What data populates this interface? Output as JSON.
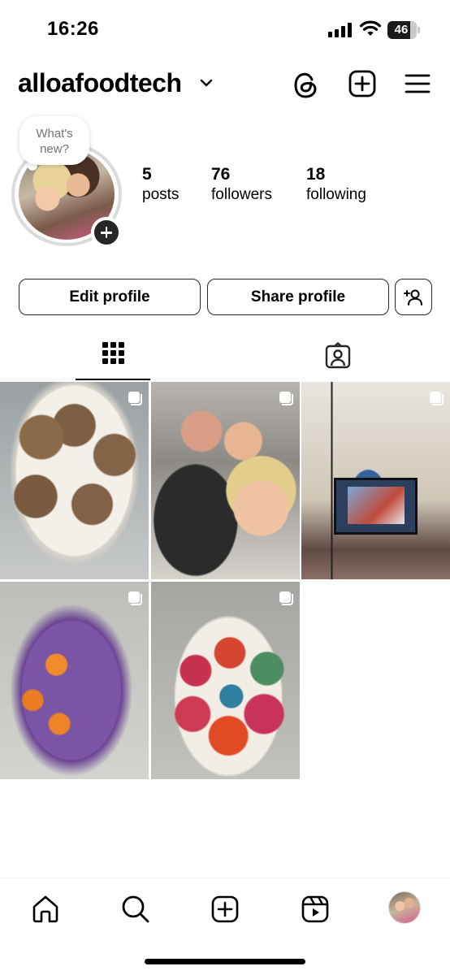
{
  "status_bar": {
    "time": "16:26",
    "battery": "46"
  },
  "header": {
    "username": "alloafoodtech"
  },
  "profile": {
    "note_placeholder": "What's new?",
    "stats": [
      {
        "value": "5",
        "label": "posts"
      },
      {
        "value": "76",
        "label": "followers"
      },
      {
        "value": "18",
        "label": "following"
      }
    ]
  },
  "actions": {
    "edit_label": "Edit profile",
    "share_label": "Share profile"
  },
  "tabs": [
    "grid-icon",
    "tagged-icon"
  ],
  "posts": [
    {
      "subject": "cupcakes-on-plate",
      "multi": true
    },
    {
      "subject": "group-selfie",
      "multi": true
    },
    {
      "subject": "classroom-screen",
      "multi": true
    },
    {
      "subject": "halloween-cake",
      "multi": true
    },
    {
      "subject": "decorated-cupcakes",
      "multi": true
    }
  ],
  "bottom_nav": [
    "home-icon",
    "search-icon",
    "create-icon",
    "reels-icon",
    "profile-avatar"
  ],
  "colors": {
    "text": "#000000",
    "secondary_text": "#737373",
    "border": "#dbdbdb"
  }
}
